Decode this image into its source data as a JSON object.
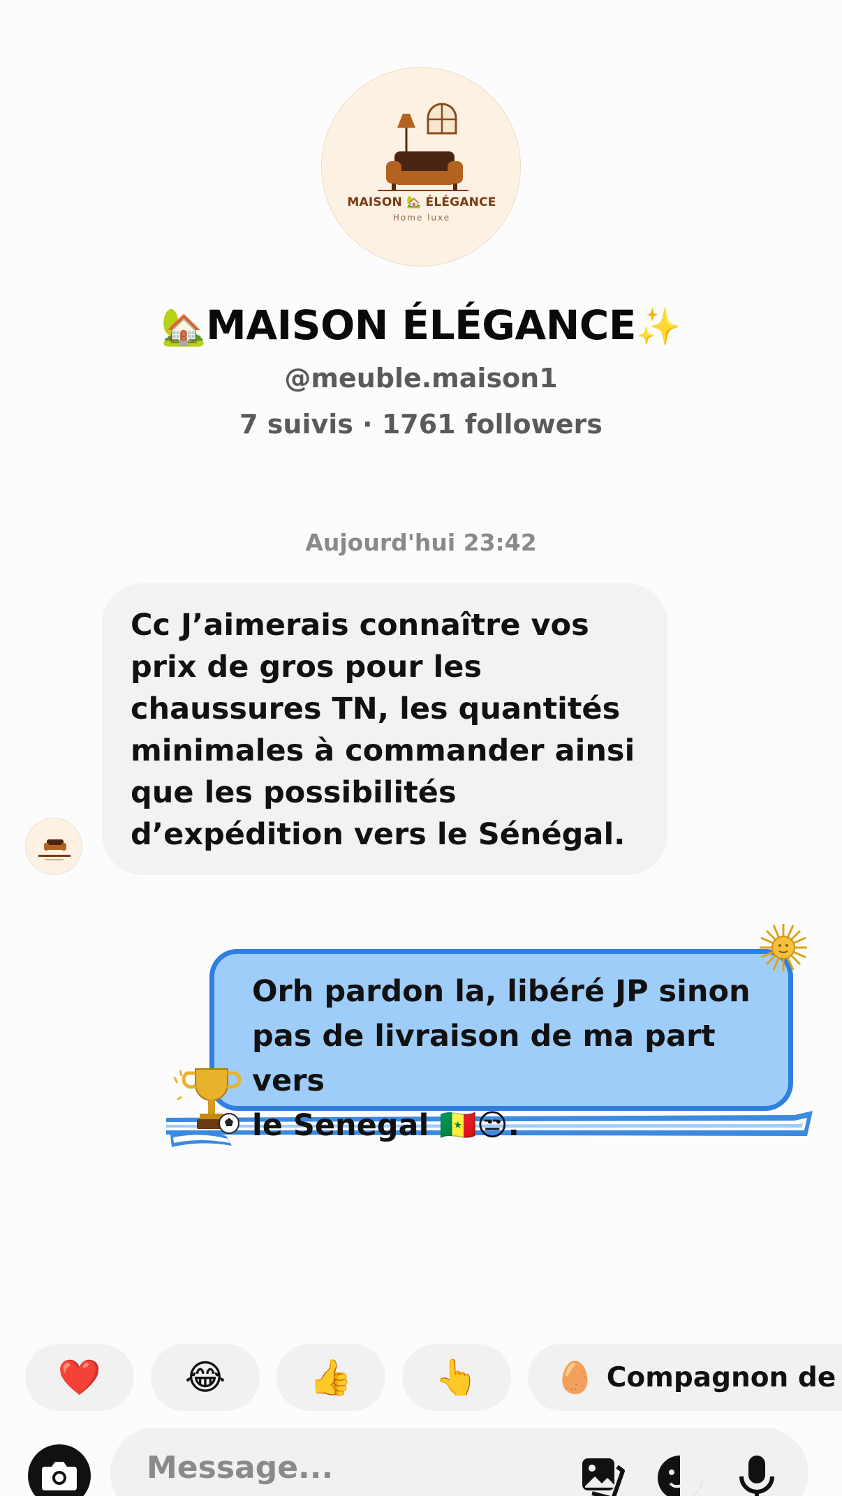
{
  "profile": {
    "logo_brand": "MAISON 🏡 ÉLÉGANCE",
    "logo_tagline": "Home luxe",
    "name_prefix_emoji": "🏡",
    "name": "MAISON ÉLÉGANCE",
    "name_suffix_emoji": "✨",
    "handle": "@meuble.maison1",
    "stats": "7 suivis · 1761 followers"
  },
  "thread": {
    "timestamp": "Aujourd'hui 23:42",
    "incoming_text": "Cc J’aimerais connaître vos prix de gros pour les chaussures TN, les quantités minimales à commander ainsi que les possibilités d’expédition vers le Sénégal.",
    "outgoing_text_line1": "Orh pardon la, libéré JP sinon",
    "outgoing_text_line2": "pas de livraison de ma part vers",
    "outgoing_text_line3": "le Senegal 🇸🇳😒."
  },
  "reactions": {
    "heart": "❤️",
    "laugh": "😂",
    "thumbs_up": "👍",
    "point": "👆",
    "companion_emoji": "🥚",
    "companion_label": "Compagnon de C"
  },
  "composer": {
    "placeholder": "Message..."
  },
  "icons": {
    "camera": "camera-icon",
    "gallery": "gallery-icon",
    "sticker": "sticker-icon",
    "mic": "microphone-icon"
  },
  "colors": {
    "outgoing_bubble": "#9fcdfa",
    "outgoing_border": "#2f7fe0",
    "incoming_bubble": "#f2f2f2",
    "logo_brown": "#7a3b12"
  }
}
